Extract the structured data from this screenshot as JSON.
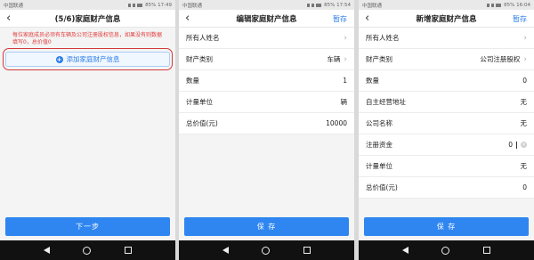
{
  "status": {
    "carrier": "中国联通",
    "p1_time": "85% 17:49",
    "p2_time": "85% 17:54",
    "p3_time": "85% 16:04"
  },
  "panel1": {
    "title": "(5/6)家庭财产信息",
    "back_icon": "chevron-left-icon",
    "notice": "每位家庭成员必须有车辆及公司注册股权信息，如果没有则数据填写0，总价值0",
    "add_button": "添加家庭财产信息",
    "next_button": "下一步"
  },
  "panel2": {
    "title": "编辑家庭财产信息",
    "action": "暂存",
    "rows": [
      {
        "label": "所有人姓名",
        "value": "",
        "chevron": true
      },
      {
        "label": "财产类别",
        "value": "车辆",
        "chevron": true
      },
      {
        "label": "数量",
        "value": "1",
        "chevron": false
      },
      {
        "label": "计量单位",
        "value": "辆",
        "chevron": false
      },
      {
        "label": "总价值(元)",
        "value": "10000",
        "chevron": false
      }
    ],
    "save_button": "保 存"
  },
  "panel3": {
    "title": "新增家庭财产信息",
    "action": "暂存",
    "rows": [
      {
        "label": "所有人姓名",
        "value": "",
        "chevron": true
      },
      {
        "label": "财产类别",
        "value": "公司注册股权",
        "chevron": true
      },
      {
        "label": "数量",
        "value": "0",
        "chevron": false
      },
      {
        "label": "自主经营地址",
        "value": "无",
        "chevron": false
      },
      {
        "label": "公司名称",
        "value": "无",
        "chevron": false
      },
      {
        "label": "注册资金",
        "value": "0",
        "chevron": false
      },
      {
        "label": "计量单位",
        "value": "无",
        "chevron": false
      },
      {
        "label": "总价值(元)",
        "value": "0",
        "chevron": false
      }
    ],
    "save_button": "保 存"
  }
}
